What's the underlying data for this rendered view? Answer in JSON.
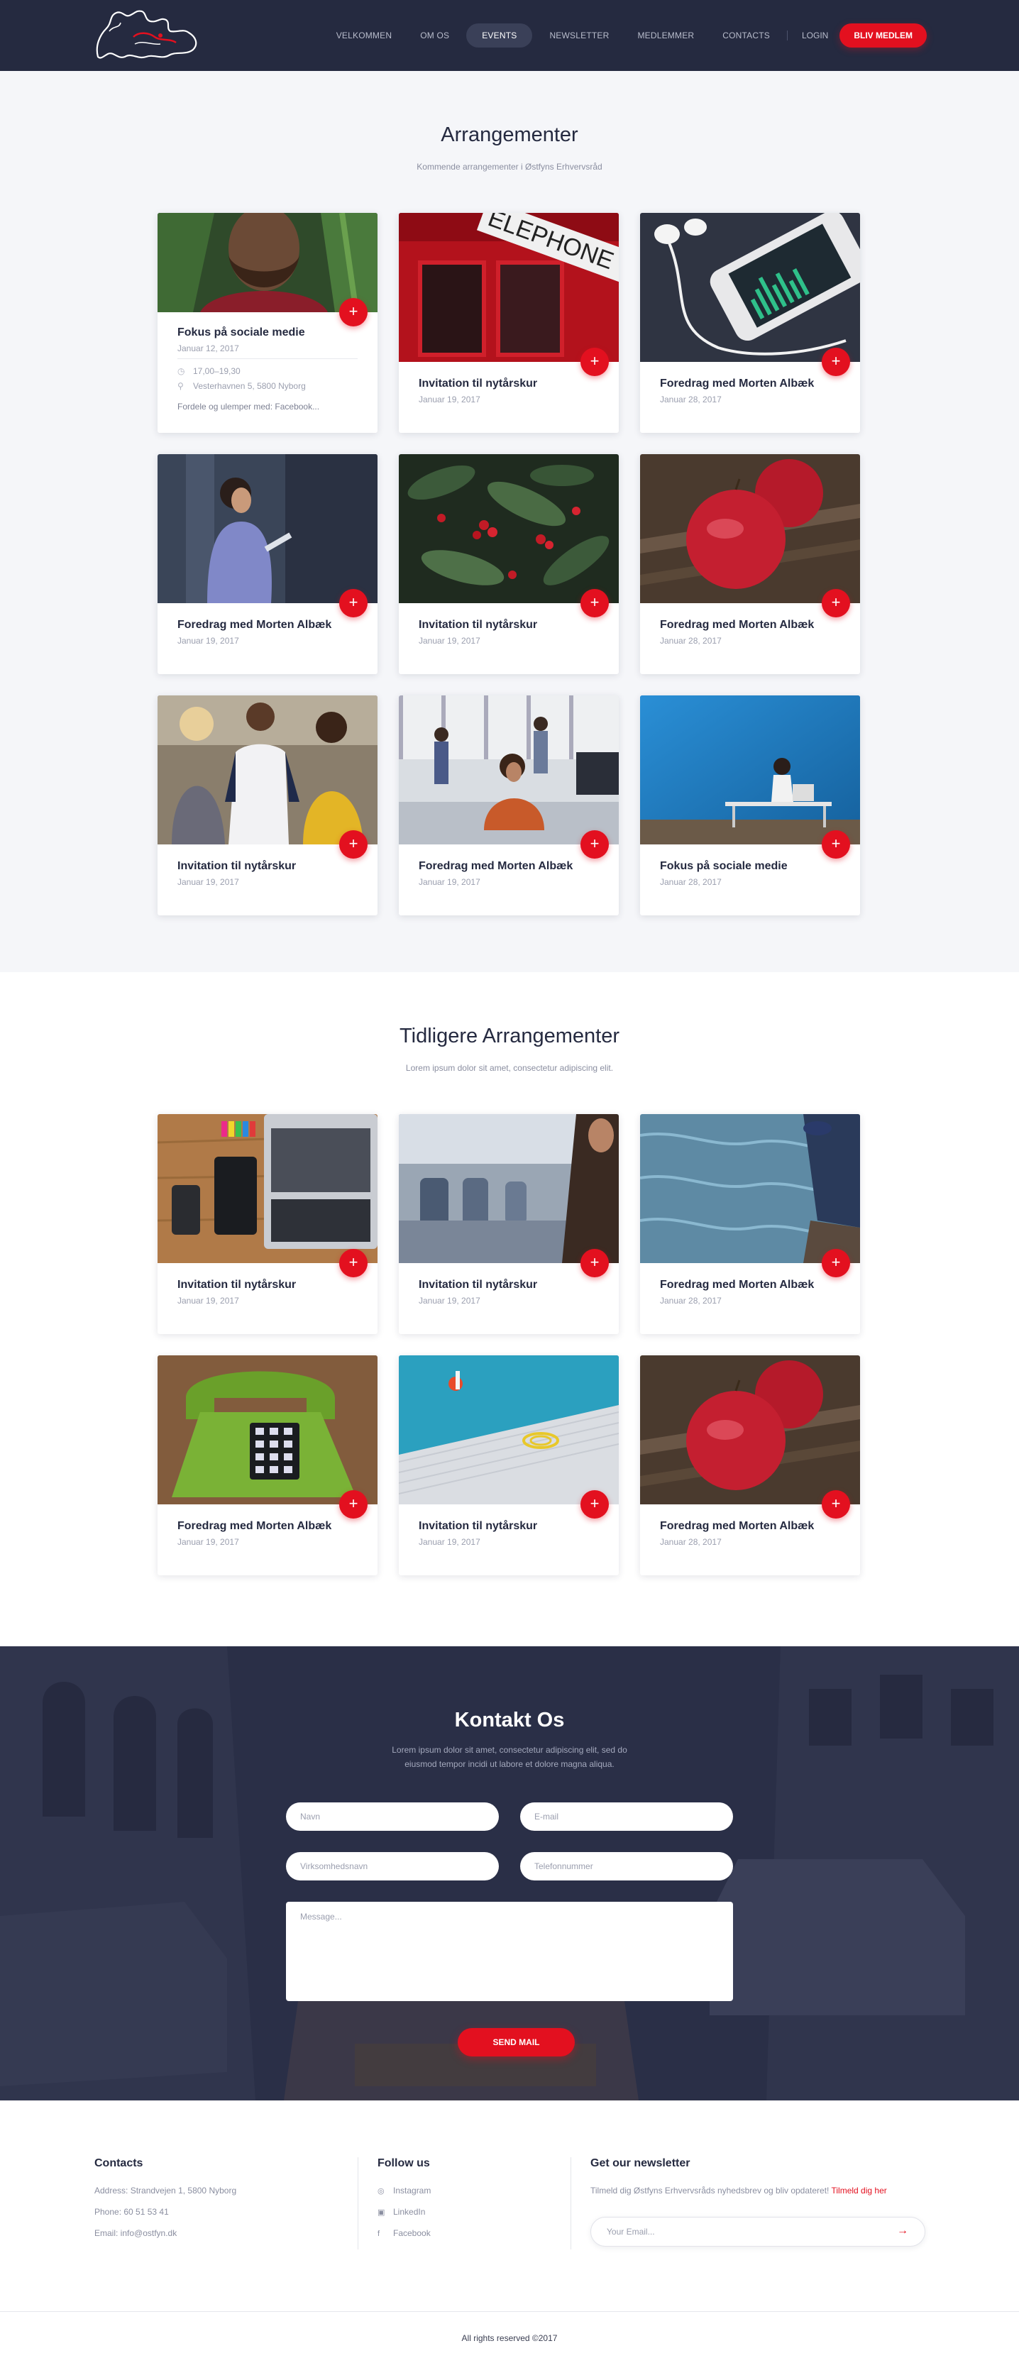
{
  "nav": {
    "items": [
      "VELKOMMEN",
      "OM OS",
      "EVENTS",
      "NEWSLETTER",
      "MEDLEMMER",
      "CONTACTS"
    ],
    "active": "EVENTS",
    "login": "LOGIN",
    "cta": "BLIV MEDLEM"
  },
  "upcoming": {
    "title": "Arrangementer",
    "subtitle": "Kommende arrangementer i Østfyns Erhvervsråd",
    "featured": {
      "title": "Fokus på sociale medie",
      "date": "Januar 12, 2017",
      "time": "17,00–19,30",
      "location": "Vesterhavnen 5, 5800 Nyborg",
      "description": "Fordele og ulemper med: Facebook..."
    },
    "cards": [
      {
        "title": "Invitation til nytårskur",
        "date": "Januar 19, 2017"
      },
      {
        "title": "Foredrag med Morten Albæk",
        "date": "Januar 28, 2017"
      },
      {
        "title": "Foredrag med Morten Albæk",
        "date": "Januar 19, 2017"
      },
      {
        "title": "Invitation til nytårskur",
        "date": "Januar 19, 2017"
      },
      {
        "title": "Foredrag med Morten Albæk",
        "date": "Januar 28, 2017"
      },
      {
        "title": "Invitation til nytårskur",
        "date": "Januar 19, 2017"
      },
      {
        "title": "Foredrag med Morten Albæk",
        "date": "Januar 19, 2017"
      },
      {
        "title": "Fokus på sociale medie",
        "date": "Januar 28, 2017"
      }
    ]
  },
  "past": {
    "title": "Tidligere Arrangementer",
    "subtitle": "Lorem ipsum dolor sit amet, consectetur adipiscing elit.",
    "cards": [
      {
        "title": "Invitation til nytårskur",
        "date": "Januar 19, 2017"
      },
      {
        "title": "Invitation til nytårskur",
        "date": "Januar 19, 2017"
      },
      {
        "title": "Foredrag med Morten Albæk",
        "date": "Januar 28, 2017"
      },
      {
        "title": "Foredrag med Morten Albæk",
        "date": "Januar 19, 2017"
      },
      {
        "title": "Invitation til nytårskur",
        "date": "Januar 19, 2017"
      },
      {
        "title": "Foredrag med Morten Albæk",
        "date": "Januar 28, 2017"
      }
    ]
  },
  "contact": {
    "title": "Kontakt Os",
    "subtitle": "Lorem ipsum dolor sit amet, consectetur adipiscing elit, sed do eiusmod tempor incidi ut labore et dolore magna aliqua.",
    "name_placeholder": "Navn",
    "email_placeholder": "E-mail",
    "company_placeholder": "Virksomhedsnavn",
    "phone_placeholder": "Telefonnummer",
    "message_placeholder": "Message...",
    "send": "SEND MAIL"
  },
  "footer": {
    "contacts": {
      "title": "Contacts",
      "address": "Address: Strandvejen 1, 5800 Nyborg",
      "phone": "Phone: 60 51 53 41",
      "email": "Email: info@ostfyn.dk"
    },
    "follow": {
      "title": "Follow us",
      "items": [
        "Instagram",
        "LinkedIn",
        "Facebook"
      ]
    },
    "newsletter": {
      "title": "Get our newsletter",
      "text": "Tilmeld dig Østfyns Erhvervsråds nyhedsbrev og bliv opdateret!",
      "link": "Tilmeld dig her",
      "placeholder": "Your Email..."
    },
    "copyright": "All rights reserved ©2017"
  },
  "colors": {
    "accent": "#e3101f",
    "navy": "#252a40",
    "section_bg": "#f5f6f9"
  },
  "icons": [
    "logo",
    "plus-icon",
    "clock-icon",
    "location-pin-icon",
    "instagram-icon",
    "linkedin-icon",
    "facebook-icon",
    "arrow-right-icon"
  ]
}
